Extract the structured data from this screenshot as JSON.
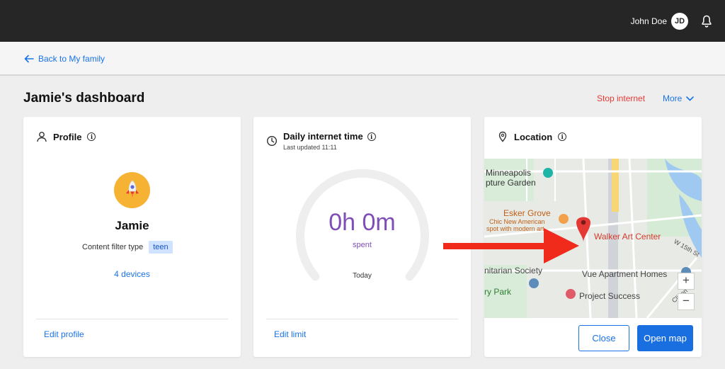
{
  "header": {
    "user_name": "John Doe",
    "user_initials": "JD",
    "icons": {
      "notifications": "bell-icon"
    }
  },
  "nav": {
    "back_label": "Back to My family"
  },
  "page": {
    "title": "Jamie's dashboard",
    "stop_internet_label": "Stop internet",
    "more_label": "More"
  },
  "profile_card": {
    "title": "Profile",
    "child_name": "Jamie",
    "filter_label": "Content filter type",
    "filter_value": "teen",
    "devices_link": "4 devices",
    "edit_label": "Edit profile",
    "avatar_icon": "rocket-icon"
  },
  "time_card": {
    "title": "Daily internet time",
    "last_updated": "Last updated 11:11",
    "time_value": "0h 0m",
    "time_caption": "spent",
    "period": "Today",
    "edit_label": "Edit limit",
    "progress": 0
  },
  "location_card": {
    "title": "Location",
    "map_labels": {
      "minneapolis": "Minneapolis",
      "sculpture_garden": "pture Garden",
      "esker_grove": "Esker Grove",
      "esker_grove_desc_1": "Chic New American",
      "esker_grove_desc_2": "spot with modern art",
      "walker_art_center": "Walker Art Center",
      "w15th": "W 15th St",
      "unitarian": "nitarian Society",
      "vue_apartment": "Vue Apartment Homes",
      "loring_park": "ry Park",
      "project_success": "Project Success",
      "clifton": "Clifton Pl"
    },
    "zoom_in": "+",
    "zoom_out": "−",
    "close_label": "Close",
    "open_map_label": "Open map"
  },
  "colors": {
    "topbar": "#262626",
    "accent": "#1a73e8",
    "danger": "#e53935",
    "time_purple": "#7e4db5",
    "pin_red": "#e53935",
    "annotation_arrow": "#f12b1b"
  }
}
